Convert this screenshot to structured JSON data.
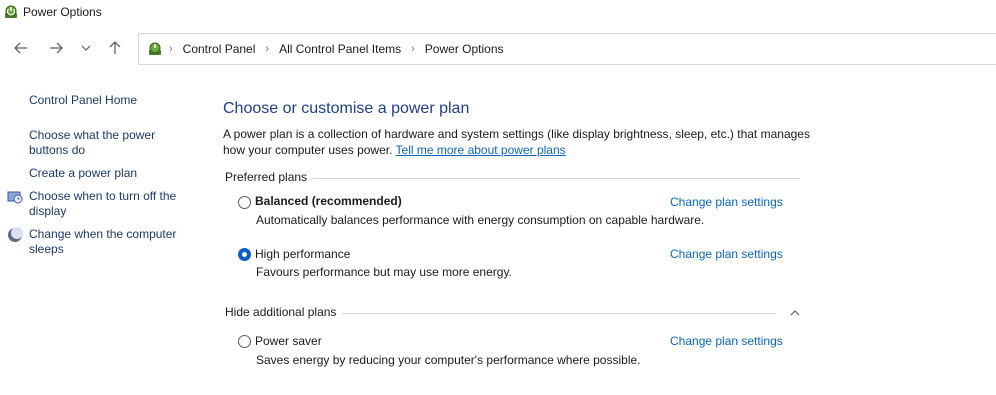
{
  "window": {
    "title": "Power Options"
  },
  "breadcrumb": [
    "Control Panel",
    "All Control Panel Items",
    "Power Options"
  ],
  "sidebar": {
    "home": "Control Panel Home",
    "links": [
      "Choose what the power buttons do",
      "Create a power plan",
      "Choose when to turn off the display",
      "Change when the computer sleeps"
    ]
  },
  "main": {
    "heading": "Choose or customise a power plan",
    "description": "A power plan is a collection of hardware and system settings (like display brightness, sleep, etc.) that manages how your computer uses power.",
    "learn_more": "Tell me more about power plans",
    "preferred_label": "Preferred plans",
    "additional_label": "Hide additional plans",
    "change_link": "Change plan settings",
    "plans": [
      {
        "name": "Balanced (recommended)",
        "desc": "Automatically balances performance with energy consumption on capable hardware.",
        "selected": false
      },
      {
        "name": "High performance",
        "desc": "Favours performance but may use more energy.",
        "selected": true
      },
      {
        "name": "Power saver",
        "desc": "Saves energy by reducing your computer's performance where possible.",
        "selected": false
      }
    ]
  },
  "colors": {
    "heading": "#1e3f8a",
    "link": "#0a66c2",
    "radio_selected": "#0a5fc9"
  },
  "icons": [
    "power-options-icon",
    "back-arrow-icon",
    "forward-arrow-icon",
    "recent-chevron-icon",
    "up-arrow-icon",
    "clock-monitor-icon",
    "moon-icon",
    "chevron-up-icon"
  ]
}
